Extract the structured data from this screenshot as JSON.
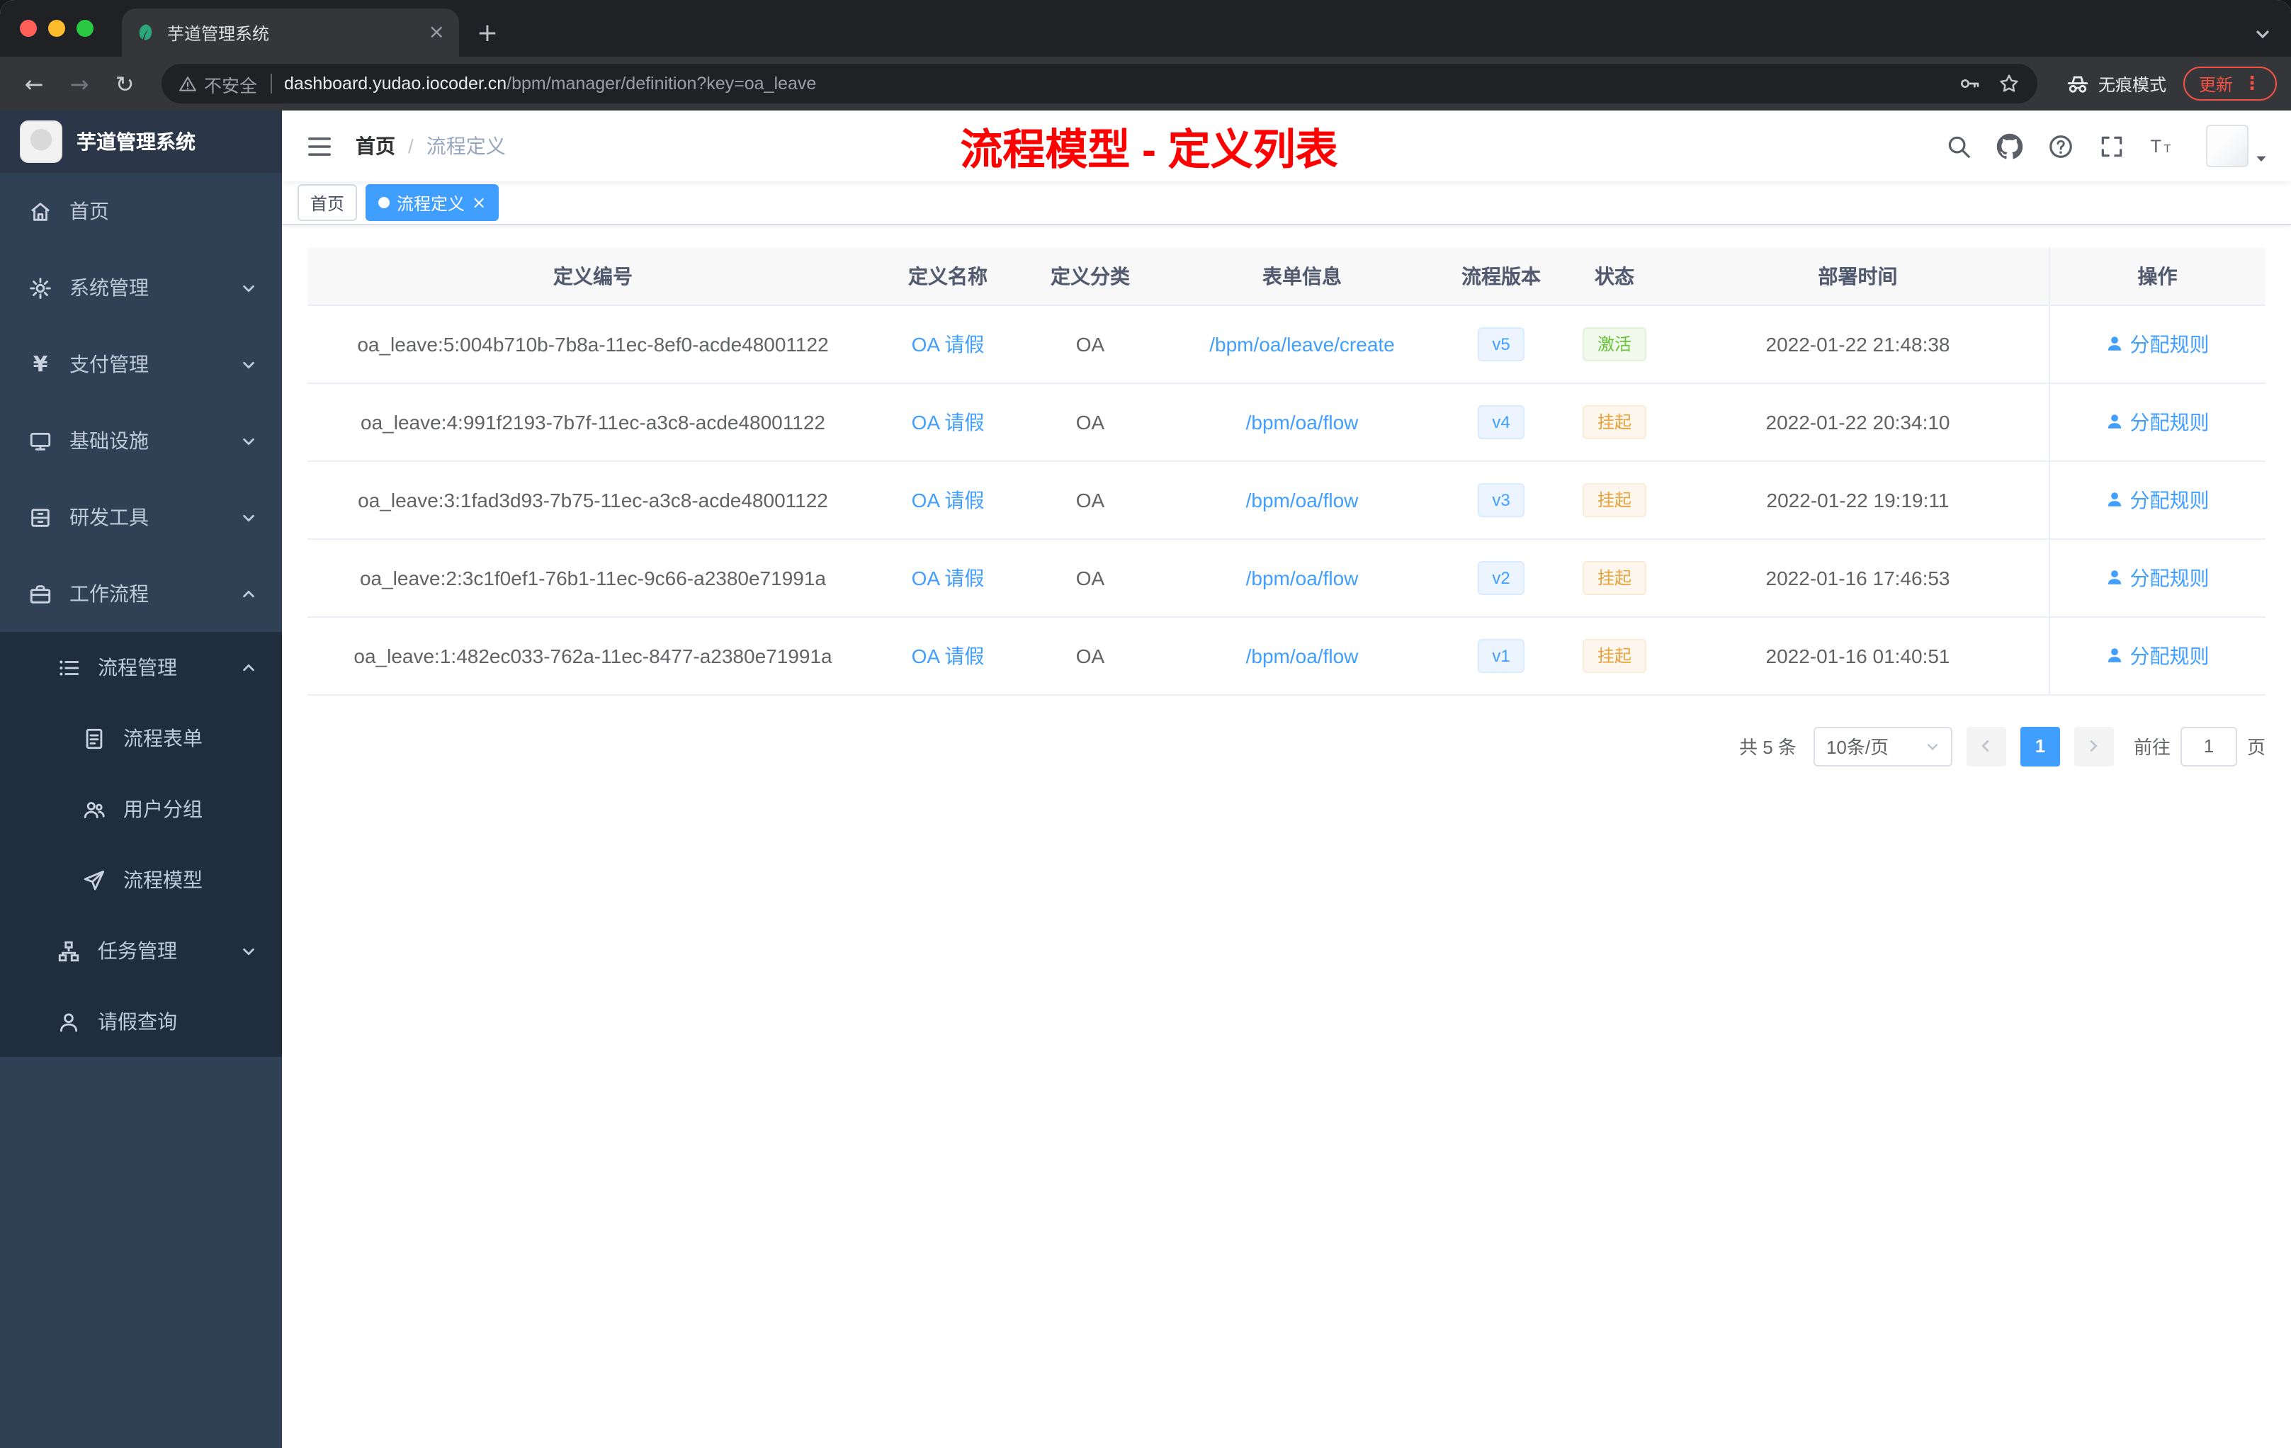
{
  "colors": {
    "accent": "#409eff",
    "success": "#67c23a",
    "warning": "#e6a23c",
    "annotation_red": "#fe0000",
    "sidebar_bg": "#304156"
  },
  "browser": {
    "tab": {
      "title": "芋道管理系统"
    },
    "address": {
      "security": "不安全",
      "host": "dashboard.yudao.iocoder.cn",
      "path": "/bpm/manager/definition?key=oa_leave"
    },
    "incognito_label": "无痕模式",
    "update_label": "更新"
  },
  "sidebar": {
    "app_title": "芋道管理系统",
    "items": [
      {
        "label": "首页"
      },
      {
        "label": "系统管理"
      },
      {
        "label": "支付管理"
      },
      {
        "label": "基础设施"
      },
      {
        "label": "研发工具"
      },
      {
        "label": "工作流程"
      },
      {
        "label": "流程管理"
      },
      {
        "label": "流程表单"
      },
      {
        "label": "用户分组"
      },
      {
        "label": "流程模型"
      },
      {
        "label": "任务管理"
      },
      {
        "label": "请假查询"
      }
    ]
  },
  "header": {
    "breadcrumb": {
      "home": "首页",
      "separator": "/",
      "current": "流程定义"
    },
    "annotation": "流程模型 - 定义列表"
  },
  "tags": [
    {
      "label": "首页"
    },
    {
      "label": "流程定义"
    }
  ],
  "table": {
    "columns": [
      "定义编号",
      "定义名称",
      "定义分类",
      "表单信息",
      "流程版本",
      "状态",
      "部署时间",
      "操作"
    ],
    "action_label": "分配规则",
    "rows": [
      {
        "id": "oa_leave:5:004b710b-7b8a-11ec-8ef0-acde48001122",
        "name": "OA 请假",
        "category": "OA",
        "form": "/bpm/oa/leave/create",
        "version": "v5",
        "status": {
          "label": "激活",
          "type": "success"
        },
        "time": "2022-01-22 21:48:38"
      },
      {
        "id": "oa_leave:4:991f2193-7b7f-11ec-a3c8-acde48001122",
        "name": "OA 请假",
        "category": "OA",
        "form": "/bpm/oa/flow",
        "version": "v4",
        "status": {
          "label": "挂起",
          "type": "warning"
        },
        "time": "2022-01-22 20:34:10"
      },
      {
        "id": "oa_leave:3:1fad3d93-7b75-11ec-a3c8-acde48001122",
        "name": "OA 请假",
        "category": "OA",
        "form": "/bpm/oa/flow",
        "version": "v3",
        "status": {
          "label": "挂起",
          "type": "warning"
        },
        "time": "2022-01-22 19:19:11"
      },
      {
        "id": "oa_leave:2:3c1f0ef1-76b1-11ec-9c66-a2380e71991a",
        "name": "OA 请假",
        "category": "OA",
        "form": "/bpm/oa/flow",
        "version": "v2",
        "status": {
          "label": "挂起",
          "type": "warning"
        },
        "time": "2022-01-16 17:46:53"
      },
      {
        "id": "oa_leave:1:482ec033-762a-11ec-8477-a2380e71991a",
        "name": "OA 请假",
        "category": "OA",
        "form": "/bpm/oa/flow",
        "version": "v1",
        "status": {
          "label": "挂起",
          "type": "warning"
        },
        "time": "2022-01-16 01:40:51"
      }
    ]
  },
  "pagination": {
    "total": "共 5 条",
    "page_size": "10条/页",
    "current_page": "1",
    "goto_prefix": "前往",
    "goto_value": "1",
    "goto_suffix": "页"
  }
}
